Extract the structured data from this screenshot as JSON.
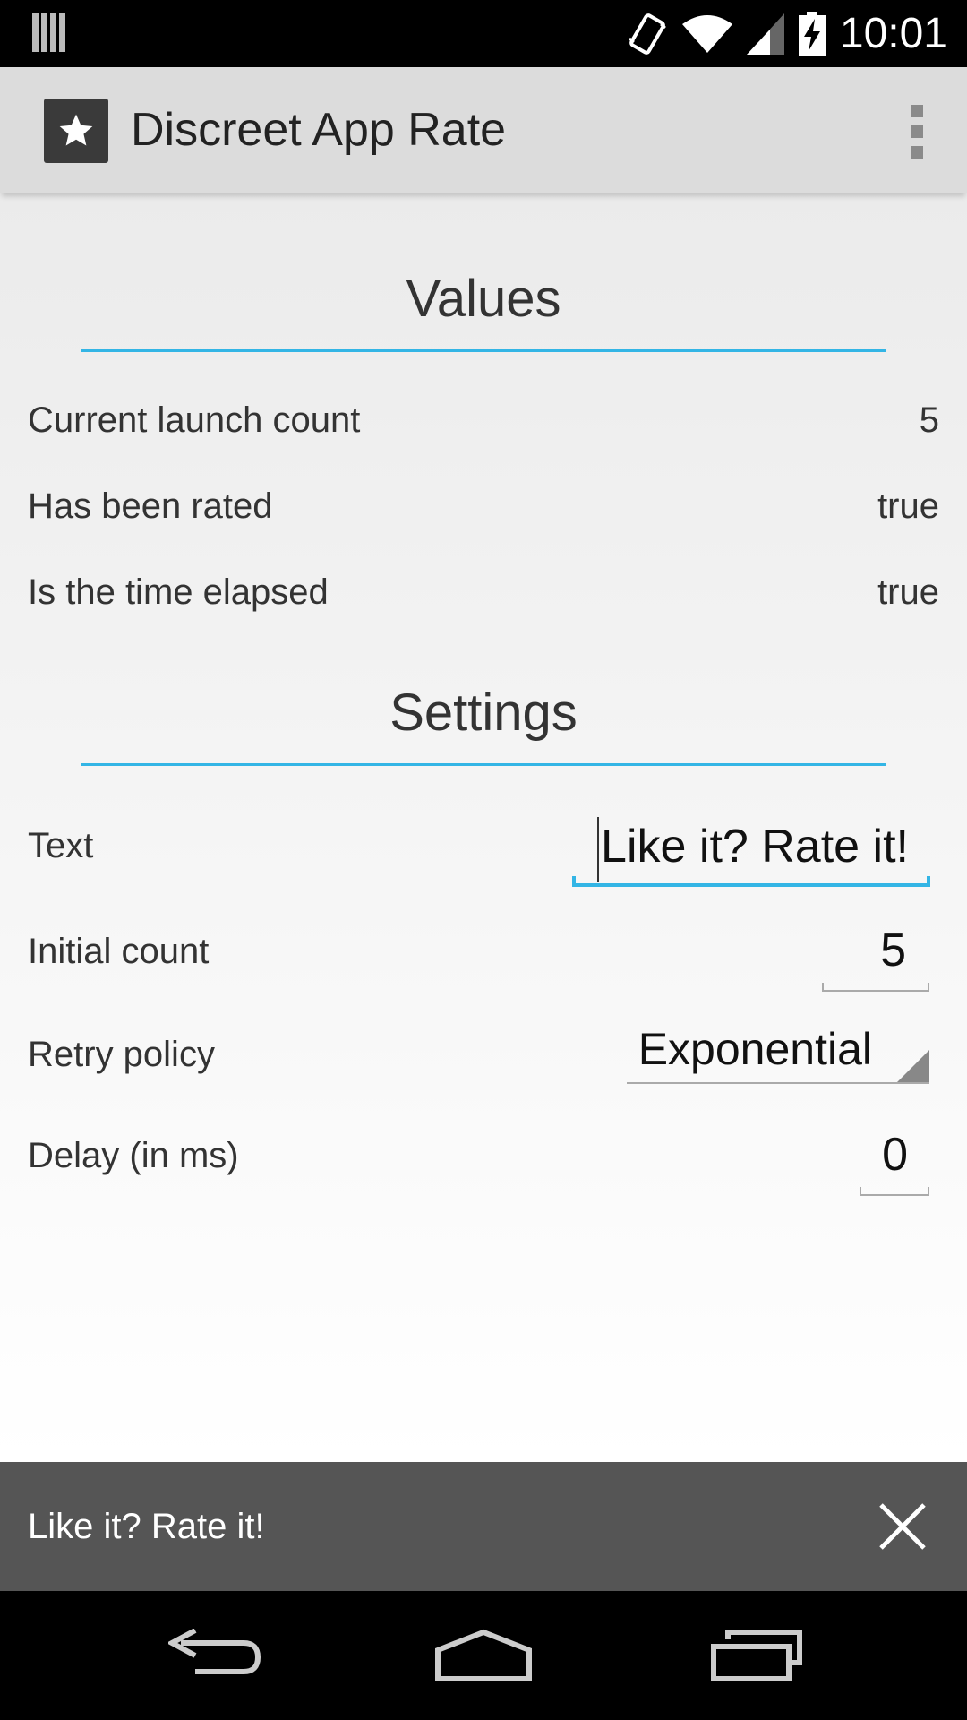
{
  "status_bar": {
    "time": "10:01",
    "icons": [
      "notification-bars-icon",
      "vibrate-icon",
      "wifi-icon",
      "signal-icon",
      "battery-charging-icon"
    ]
  },
  "action_bar": {
    "title": "Discreet App Rate",
    "icon": "star-icon",
    "overflow_icon": "overflow-menu-icon"
  },
  "values": {
    "title": "Values",
    "rows": [
      {
        "label": "Current launch count",
        "value": "5"
      },
      {
        "label": "Has been rated",
        "value": "true"
      },
      {
        "label": "Is the time elapsed",
        "value": "true"
      }
    ]
  },
  "settings": {
    "title": "Settings",
    "text_label": "Text",
    "text_value": "Like it? Rate it!",
    "initial_count_label": "Initial count",
    "initial_count_value": "5",
    "retry_policy_label": "Retry policy",
    "retry_policy_value": "Exponential",
    "delay_label": "Delay (in ms)",
    "delay_value": "0"
  },
  "snackbar": {
    "text": "Like it? Rate it!",
    "close_icon": "close-icon"
  },
  "nav_bar": {
    "buttons": [
      "back-icon",
      "home-icon",
      "recents-icon"
    ]
  },
  "colors": {
    "accent": "#33b5e5",
    "action_bar": "#dcdcdc",
    "snackbar": "#555555"
  }
}
